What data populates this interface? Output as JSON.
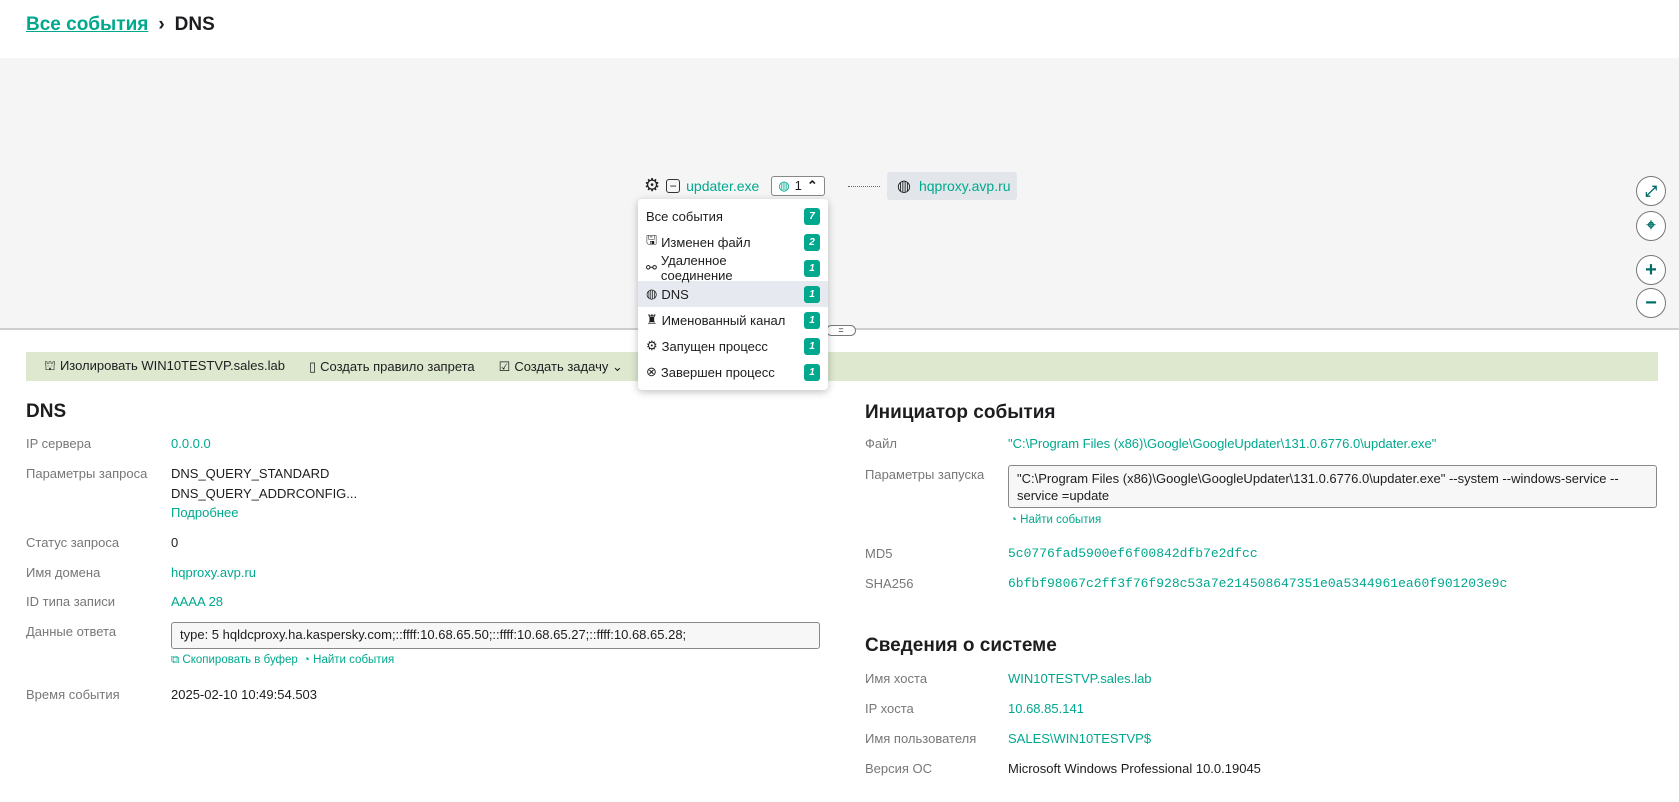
{
  "breadcrumb": {
    "home": "Все события",
    "sep": "›",
    "current": "DNS"
  },
  "graph": {
    "process": {
      "name": "updater.exe",
      "events_count": "1"
    },
    "dns_node": {
      "label": "hqproxy.avp.ru"
    },
    "menu": [
      {
        "icon": "globe-dns-icon",
        "glyph": "◍",
        "label": "Все события",
        "count": "7",
        "selected": false,
        "noicon": true
      },
      {
        "icon": "file-changed-icon",
        "glyph": "🖫",
        "label": "Изменен файл",
        "count": "2",
        "selected": false
      },
      {
        "icon": "remote-connection-icon",
        "glyph": "⚯",
        "label": "Удаленное соединение",
        "count": "1",
        "selected": false
      },
      {
        "icon": "dns-icon",
        "glyph": "◍",
        "label": "DNS",
        "count": "1",
        "selected": true
      },
      {
        "icon": "named-pipe-icon",
        "glyph": "♜",
        "label": "Именованный канал",
        "count": "1",
        "selected": false
      },
      {
        "icon": "gear-icon",
        "glyph": "⚙",
        "label": "Запущен процесс",
        "count": "1",
        "selected": false
      },
      {
        "icon": "close-circle-icon",
        "glyph": "⊗",
        "label": "Завершен процесс",
        "count": "1",
        "selected": false
      }
    ],
    "controls": [
      "fit-screen-icon",
      "center-icon",
      "zoom-in-icon",
      "zoom-out-icon"
    ]
  },
  "actions": {
    "isolate": "Изолировать WIN10TESTVP.sales.lab",
    "rule": "Создать правило запрета",
    "task": "Создать задачу"
  },
  "dns": {
    "title": "DNS",
    "ip_label": "IP сервера",
    "ip": "0.0.0.0",
    "params_label": "Параметры запроса",
    "params1": "DNS_QUERY_STANDARD",
    "params2": "DNS_QUERY_ADDRCONFIG...",
    "more": "Подробнее",
    "status_label": "Статус запроса",
    "status": "0",
    "domain_label": "Имя домена",
    "domain": "hqproxy.avp.ru",
    "type_label": "ID типа записи",
    "type": "AAAA 28",
    "answer_label": "Данные ответа",
    "answer": "type:  5 hqldcproxy.ha.kaspersky.com;::ffff:10.68.65.50;::ffff:10.68.65.27;::ffff:10.68.65.28;",
    "copy": "Скопировать в буфер",
    "find": "Найти события",
    "time_label": "Время события",
    "time": "2025-02-10 10:49:54.503"
  },
  "initiator": {
    "title": "Инициатор события",
    "file_label": "Файл",
    "file": "\"C:\\Program Files (x86)\\Google\\GoogleUpdater\\131.0.6776.0\\updater.exe\"",
    "cmd_label": "Параметры запуска",
    "cmd": "\"C:\\Program Files (x86)\\Google\\GoogleUpdater\\131.0.6776.0\\updater.exe\" --system --windows-service --service =update",
    "find": "Найти события",
    "md5_label": "MD5",
    "md5": "5c0776fad5900ef6f00842dfb7e2dfcc",
    "sha_label": "SHA256",
    "sha": "6bfbf98067c2ff3f76f928c53a7e214508647351e0a5344961ea60f901203e9c"
  },
  "system": {
    "title": "Сведения о системе",
    "host_label": "Имя хоста",
    "host": "WIN10TESTVP.sales.lab",
    "ip_label": "IP хоста",
    "ip": "10.68.85.141",
    "user_label": "Имя пользователя",
    "user": "SALES\\WIN10TESTVP$",
    "os_label": "Версия ОС",
    "os": "Microsoft Windows Professional 10.0.19045"
  },
  "colors": {
    "accent": "#00a88e",
    "action_bar": "#dde8cf",
    "graph_bg": "#f5f5f5"
  }
}
